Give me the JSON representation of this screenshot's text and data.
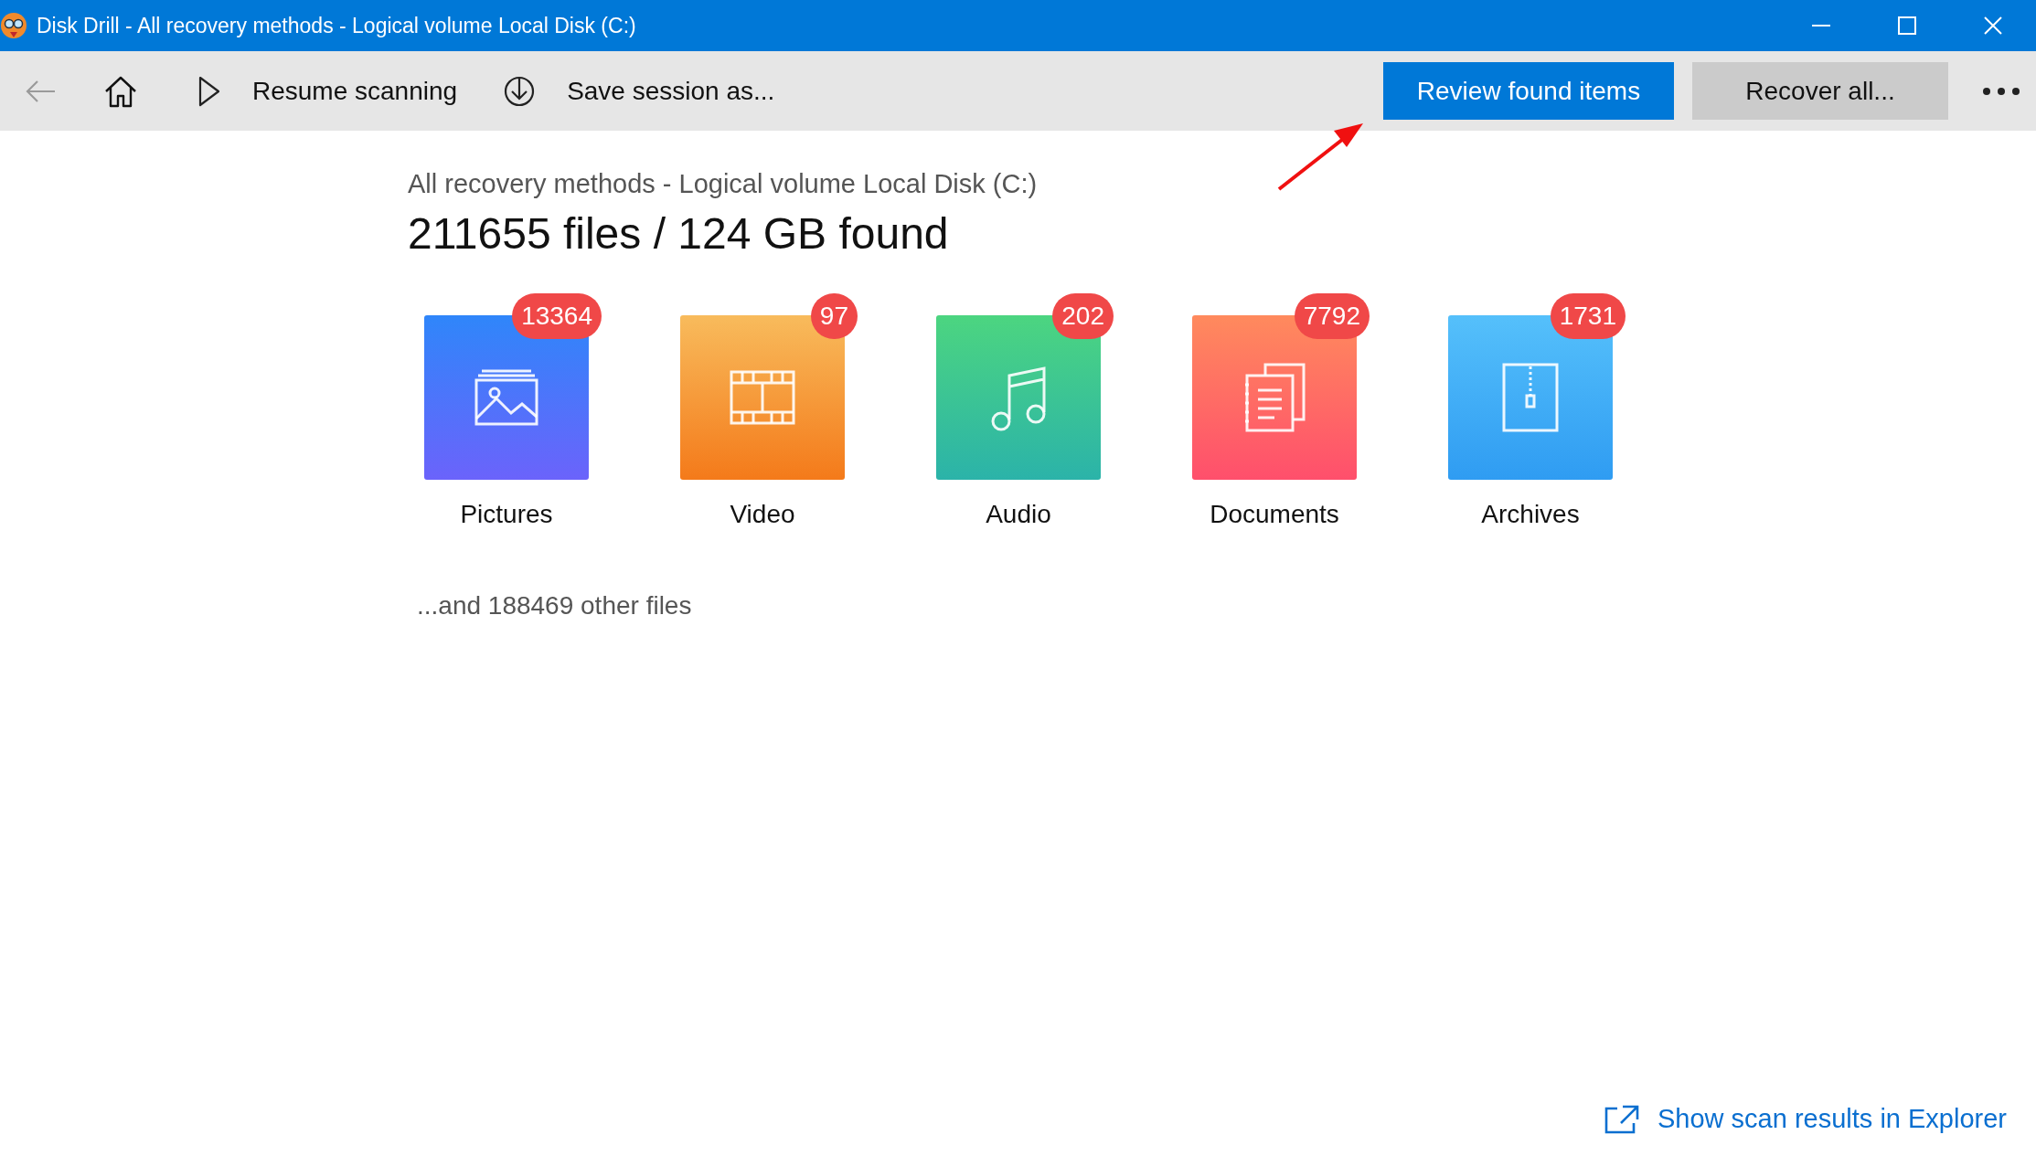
{
  "window": {
    "title": "Disk Drill - All recovery methods - Logical volume Local Disk (C:)"
  },
  "toolbar": {
    "back": {
      "disabled": true
    },
    "actions": [
      {
        "kind": "resume",
        "label": "Resume scanning"
      },
      {
        "kind": "save",
        "label": "Save session as..."
      }
    ],
    "buttons": [
      {
        "kind": "primary",
        "label": "Review found items"
      },
      {
        "kind": "secondary",
        "label": "Recover all..."
      }
    ]
  },
  "summary": {
    "subtitle": "All recovery methods - Logical volume Local Disk (C:)",
    "heading": "211655 files / 124 GB found"
  },
  "categories": [
    {
      "kind": "pictures",
      "label": "Pictures",
      "count": "13364"
    },
    {
      "kind": "video",
      "label": "Video",
      "count": "97"
    },
    {
      "kind": "audio",
      "label": "Audio",
      "count": "202"
    },
    {
      "kind": "documents",
      "label": "Documents",
      "count": "7792"
    },
    {
      "kind": "archives",
      "label": "Archives",
      "count": "1731"
    }
  ],
  "other_files": "...and 188469 other files",
  "explorer_link": "Show scan results in Explorer"
}
